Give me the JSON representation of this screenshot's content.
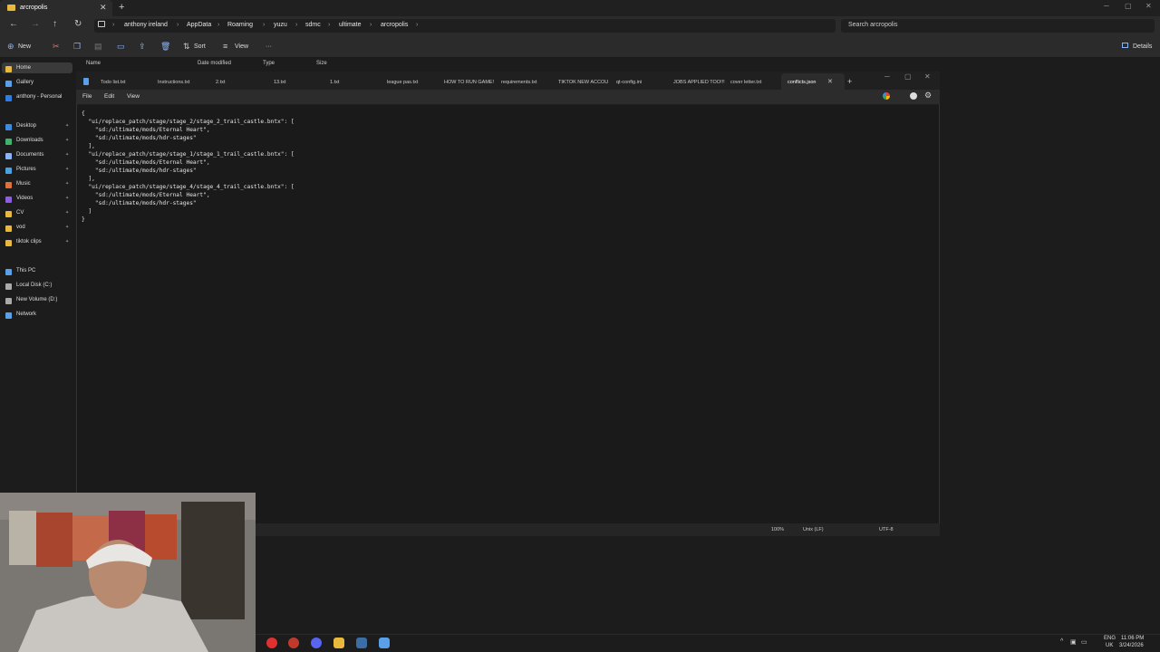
{
  "explorer": {
    "tab_title": "arcropolis",
    "breadcrumbs": [
      "anthony ireland",
      "AppData",
      "Roaming",
      "yuzu",
      "sdmc",
      "ultimate",
      "arcropolis"
    ],
    "search_placeholder": "Search arcropolis",
    "toolbar": {
      "new": "New",
      "sort": "Sort",
      "view": "View",
      "more": "···",
      "details": "Details"
    },
    "columns": [
      "Name",
      "Date modified",
      "Type",
      "Size"
    ],
    "sidebar": {
      "quick": [
        {
          "label": "Home",
          "color": "#e8b93a"
        },
        {
          "label": "Gallery",
          "color": "#5aa0e8"
        },
        {
          "label": "anthony - Personal",
          "color": "#2f7de1"
        }
      ],
      "pinned": [
        {
          "label": "Desktop",
          "color": "#3b8be0"
        },
        {
          "label": "Downloads",
          "color": "#3fb36b"
        },
        {
          "label": "Documents",
          "color": "#8ab4f8"
        },
        {
          "label": "Pictures",
          "color": "#4aa3df"
        },
        {
          "label": "Music",
          "color": "#e0703b"
        },
        {
          "label": "Videos",
          "color": "#8f5de0"
        },
        {
          "label": "CV",
          "color": "#e8b93a"
        },
        {
          "label": "vod",
          "color": "#e8b93a"
        },
        {
          "label": "tiktok clips",
          "color": "#e8b93a"
        }
      ],
      "devices": [
        {
          "label": "This PC",
          "color": "#5aa0e8"
        },
        {
          "label": "Local Disk (C:)",
          "color": "#aaaaaa"
        },
        {
          "label": "New Volume (D:)",
          "color": "#aaaaaa"
        },
        {
          "label": "Network",
          "color": "#5aa0e8"
        }
      ]
    }
  },
  "notepad": {
    "tabs": [
      "Todo list.txt",
      "Instructions.txt",
      "2.txt",
      "13.txt",
      "1.txt",
      "league pas.txt",
      "HOW TO RUN GAME!",
      "requirements.txt",
      "TIKTOK NEW ACCOU",
      "qt-config.ini",
      "JOBS APPLIED TOO!!!",
      "cover letter.txt",
      "conflicts.json"
    ],
    "active_tab": "conflicts.json",
    "menu": [
      "File",
      "Edit",
      "View"
    ],
    "content": "{\n  \"ui/replace_patch/stage/stage_2/stage_2_trail_castle.bntx\": [\n    \"sd:/ultimate/mods/Eternal Heart\",\n    \"sd:/ultimate/mods/hdr-stages\"\n  ],\n  \"ui/replace_patch/stage/stage_1/stage_1_trail_castle.bntx\": [\n    \"sd:/ultimate/mods/Eternal Heart\",\n    \"sd:/ultimate/mods/hdr-stages\"\n  ],\n  \"ui/replace_patch/stage/stage_4/stage_4_trail_castle.bntx\": [\n    \"sd:/ultimate/mods/Eternal Heart\",\n    \"sd:/ultimate/mods/hdr-stages\"\n  ]\n}",
    "status": {
      "zoom": "100%",
      "line_ending": "Unix (LF)",
      "encoding": "UTF-8"
    }
  },
  "taskbar": {
    "lang": "ENG",
    "region": "UK",
    "time": "11:06 PM",
    "date": "3/24/2026"
  }
}
